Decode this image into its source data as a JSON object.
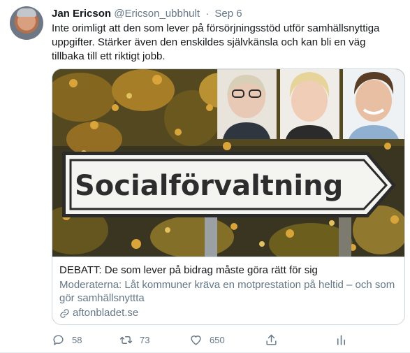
{
  "tweet": {
    "author_name": "Jan Ericson",
    "author_handle": "@Ericson_ubbhult",
    "separator": "·",
    "date": "Sep 6",
    "text": "Inte orimligt att den som lever på försörjningsstöd utför samhällsnyttiga uppgifter. Stärker även den enskildes självkänsla och kan bli en väg tillbaka till ett riktigt jobb."
  },
  "card": {
    "sign_text": "Socialförvaltning",
    "title": "DEBATT: De som lever på bidrag måste göra rätt för sig",
    "description": "Moderaterna: Låt kommuner kräva en motprestation på heltid – och som gör samhällsnyttta",
    "domain": "aftonbladet.se",
    "domain_icon": "link-icon"
  },
  "actions": {
    "reply_count": "58",
    "retweet_count": "73",
    "like_count": "650",
    "icons": [
      "reply-icon",
      "retweet-icon",
      "like-icon",
      "share-icon",
      "analytics-icon"
    ]
  },
  "colors": {
    "text_primary": "#14171a",
    "text_secondary": "#657786",
    "border": "#ccd6dd"
  }
}
